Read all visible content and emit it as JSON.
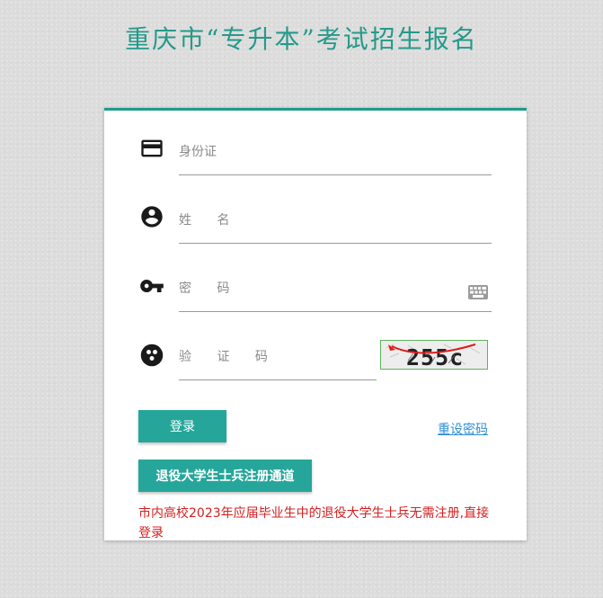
{
  "header": {
    "title": "重庆市“专升本”考试招生报名"
  },
  "form": {
    "id_card_placeholder": "身份证",
    "name_placeholder": "姓 名",
    "password_placeholder": "密 码",
    "captcha_placeholder": "验 证 码",
    "captcha_text": "255c"
  },
  "actions": {
    "login_label": "登录",
    "reset_password_label": "重设密码",
    "veteran_register_label": "退役大学生士兵注册通道"
  },
  "notice": {
    "text": "市内高校2023年应届毕业生中的退役大学生士兵无需注册,直接登录"
  },
  "icons": {
    "id_card": "credit-card-icon",
    "name": "account-circle-icon",
    "password": "key-icon",
    "captcha": "dots-circle-icon",
    "keyboard": "keyboard-icon"
  },
  "colors": {
    "accent": "#26a69a",
    "title": "#26998a",
    "link": "#2f8fd6",
    "notice": "#d42020"
  }
}
